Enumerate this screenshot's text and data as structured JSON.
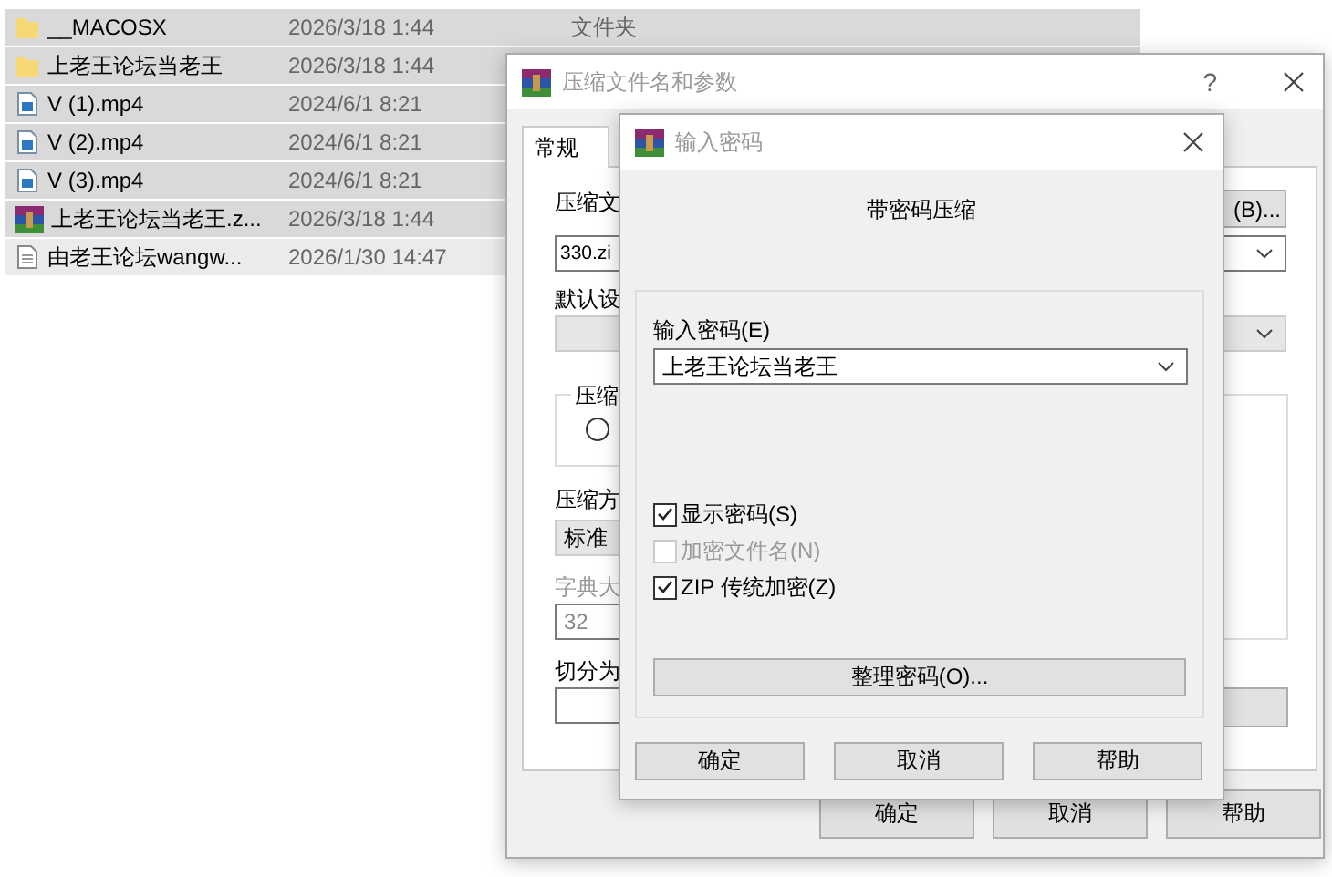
{
  "file_list": {
    "rows": [
      {
        "kind": "folder",
        "name": "__MACOSX",
        "date": "2026/3/18 1:44",
        "type": "文件夹",
        "selected": true
      },
      {
        "kind": "folder",
        "name": "上老王论坛当老王",
        "date": "2026/3/18 1:44",
        "selected": true
      },
      {
        "kind": "video",
        "name": "V (1).mp4",
        "date": "2024/6/1 8:21",
        "selected": true
      },
      {
        "kind": "video",
        "name": "V (2).mp4",
        "date": "2024/6/1 8:21",
        "selected": true
      },
      {
        "kind": "video",
        "name": "V (3).mp4",
        "date": "2024/6/1 8:21",
        "selected": true
      },
      {
        "kind": "archive",
        "name": "上老王论坛当老王.z...",
        "date": "2026/3/18 1:44",
        "selected": true
      },
      {
        "kind": "text",
        "name": "由老王论坛wangw...",
        "date": "2026/1/30 14:47",
        "selected": false
      }
    ]
  },
  "archive_dialog": {
    "title": "压缩文件名和参数",
    "help": "?",
    "tabs": [
      {
        "label": "常规",
        "selected": true
      }
    ],
    "archive_name_label": "压缩文",
    "browse_button": "(B)...",
    "archive_name": "330.zi",
    "profile_label": "默认设",
    "format_group_label": "压缩",
    "format_radio": {
      "selected": false
    },
    "method_label": "压缩方",
    "method": "标准",
    "dictionary_label": "字典大",
    "dictionary": "32",
    "dictionary_disabled": true,
    "split_label": "切分为",
    "buttons": [
      "确定",
      "取消",
      "帮助"
    ]
  },
  "password_dialog": {
    "title": "输入密码",
    "heading": "带密码压缩",
    "password_label": "输入密码(E)",
    "password": "上老王论坛当老王",
    "options": [
      {
        "label": "显示密码(S)",
        "checked": true,
        "disabled": false
      },
      {
        "label": "加密文件名(N)",
        "checked": false,
        "disabled": true
      },
      {
        "label": "ZIP 传统加密(Z)",
        "checked": true,
        "disabled": false
      }
    ],
    "manage_button": "整理密码(O)...",
    "buttons": [
      "确定",
      "取消",
      "帮助"
    ]
  }
}
